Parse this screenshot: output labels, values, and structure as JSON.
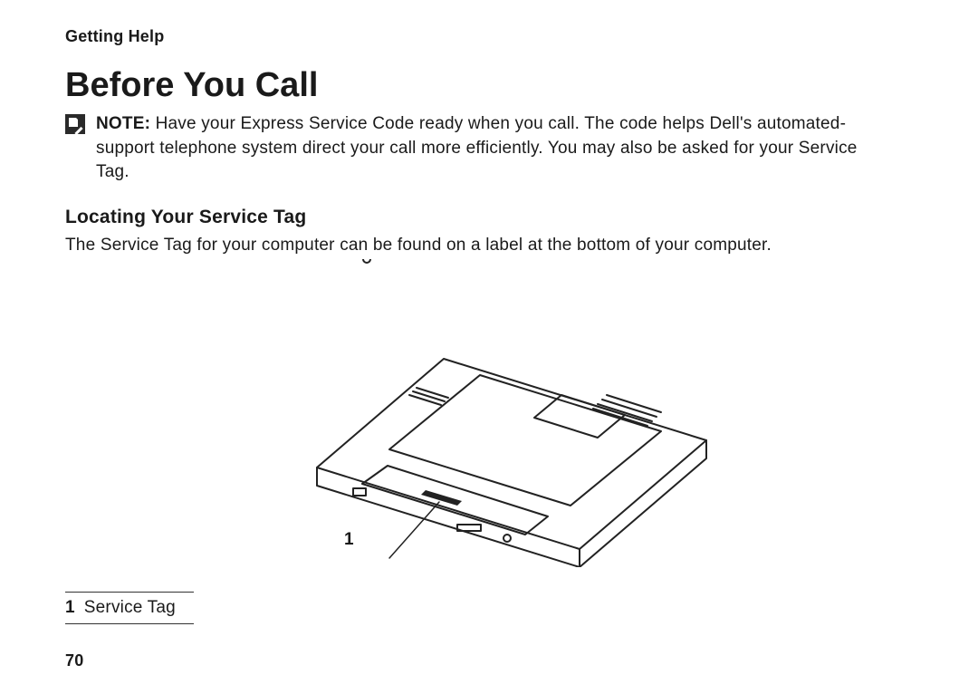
{
  "header": {
    "section": "Getting Help"
  },
  "title": "Before You Call",
  "note": {
    "label": "NOTE:",
    "text": " Have your Express Service Code ready when you call. The code helps Dell's automated-support telephone system direct your call more efficiently. You may also be asked for your Service Tag."
  },
  "subhead": "Locating Your Service Tag",
  "body": "The Service Tag for your computer can be found on a label at the bottom of your computer.",
  "callouts": {
    "diagram_label": "1"
  },
  "legend": {
    "items": [
      {
        "num": "1",
        "label": "Service Tag"
      }
    ]
  },
  "page_number": "70"
}
